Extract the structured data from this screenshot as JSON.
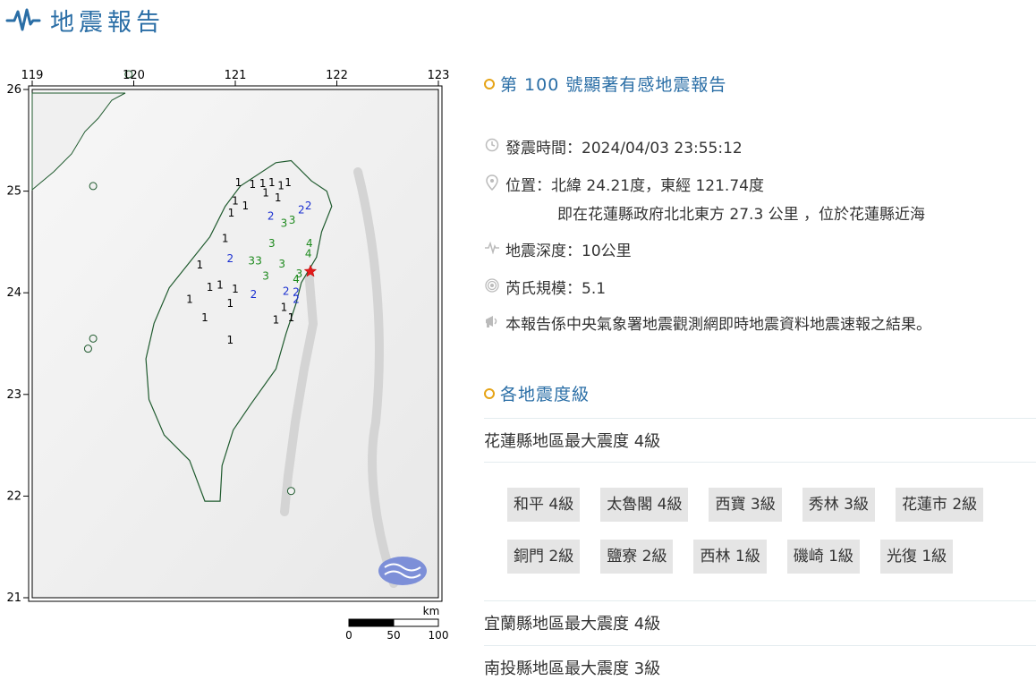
{
  "header": {
    "title": "地震報告",
    "icon": "seismograph-icon",
    "accent": "#2a6ea6"
  },
  "map": {
    "lon_ticks": [
      "119",
      "120",
      "121",
      "122",
      "123"
    ],
    "lat_ticks": [
      "26",
      "25",
      "24",
      "23",
      "22",
      "21"
    ],
    "scale_label": "km",
    "scale_ticks": [
      "0",
      "50",
      "100"
    ],
    "epicenter_marker": "red-star-icon",
    "intensity_labels": [
      {
        "v": "1",
        "lon": 121.03,
        "lat": 25.05
      },
      {
        "v": "1",
        "lon": 121.17,
        "lat": 25.03
      },
      {
        "v": "1",
        "lon": 121.27,
        "lat": 25.04
      },
      {
        "v": "1",
        "lon": 121.36,
        "lat": 25.05
      },
      {
        "v": "1",
        "lon": 121.45,
        "lat": 25.02
      },
      {
        "v": "1",
        "lon": 121.52,
        "lat": 25.05
      },
      {
        "v": "1",
        "lon": 121.0,
        "lat": 24.87
      },
      {
        "v": "1",
        "lon": 121.1,
        "lat": 24.82
      },
      {
        "v": "1",
        "lon": 120.96,
        "lat": 24.75
      },
      {
        "v": "1",
        "lon": 121.3,
        "lat": 24.95
      },
      {
        "v": "1",
        "lon": 121.42,
        "lat": 24.9
      },
      {
        "v": "2",
        "lon": 121.35,
        "lat": 24.72
      },
      {
        "v": "2",
        "lon": 121.65,
        "lat": 24.78
      },
      {
        "v": "2",
        "lon": 121.72,
        "lat": 24.82
      },
      {
        "v": "3",
        "lon": 121.48,
        "lat": 24.65
      },
      {
        "v": "3",
        "lon": 121.56,
        "lat": 24.68
      },
      {
        "v": "3",
        "lon": 121.36,
        "lat": 24.45
      },
      {
        "v": "1",
        "lon": 120.9,
        "lat": 24.5
      },
      {
        "v": "2",
        "lon": 120.95,
        "lat": 24.3
      },
      {
        "v": "3",
        "lon": 121.16,
        "lat": 24.28
      },
      {
        "v": "3",
        "lon": 121.23,
        "lat": 24.28
      },
      {
        "v": "3",
        "lon": 121.46,
        "lat": 24.25
      },
      {
        "v": "4",
        "lon": 121.73,
        "lat": 24.45
      },
      {
        "v": "4",
        "lon": 121.72,
        "lat": 24.35
      },
      {
        "v": "3",
        "lon": 121.63,
        "lat": 24.15
      },
      {
        "v": "4",
        "lon": 121.6,
        "lat": 24.1
      },
      {
        "v": "3",
        "lon": 121.3,
        "lat": 24.13
      },
      {
        "v": "1",
        "lon": 120.65,
        "lat": 24.24
      },
      {
        "v": "1",
        "lon": 120.75,
        "lat": 24.02
      },
      {
        "v": "1",
        "lon": 120.85,
        "lat": 24.04
      },
      {
        "v": "1",
        "lon": 121.0,
        "lat": 24.0
      },
      {
        "v": "1",
        "lon": 120.55,
        "lat": 23.9
      },
      {
        "v": "1",
        "lon": 120.7,
        "lat": 23.72
      },
      {
        "v": "2",
        "lon": 121.18,
        "lat": 23.95
      },
      {
        "v": "2",
        "lon": 121.5,
        "lat": 23.98
      },
      {
        "v": "2",
        "lon": 121.6,
        "lat": 23.97
      },
      {
        "v": "2",
        "lon": 121.6,
        "lat": 23.9
      },
      {
        "v": "1",
        "lon": 121.48,
        "lat": 23.82
      },
      {
        "v": "1",
        "lon": 121.4,
        "lat": 23.7
      },
      {
        "v": "1",
        "lon": 121.55,
        "lat": 23.72
      },
      {
        "v": "1",
        "lon": 120.95,
        "lat": 23.86
      },
      {
        "v": "1",
        "lon": 120.95,
        "lat": 23.5
      }
    ]
  },
  "report": {
    "title": "第 100 號顯著有感地震報告",
    "time_label": "發震時間：2024/04/03 23:55:12",
    "location_label": "位置：北緯 24.21度，東經 121.74度",
    "location_detail": "即在花蓮縣政府北北東方 27.3 公里 ，位於花蓮縣近海",
    "depth_label": "地震深度：10公里",
    "magnitude_label": "芮氏規模：5.1",
    "note": "本報告係中央氣象署地震觀測網即時地震資料地震速報之結果。"
  },
  "intensity": {
    "title": "各地震度級",
    "counties": [
      {
        "label": "花蓮縣地區最大震度 4級"
      },
      {
        "label": "宜蘭縣地區最大震度 4級"
      },
      {
        "label": "南投縣地區最大震度 3級"
      }
    ],
    "stations": [
      "和平 4級",
      "太魯閣 4級",
      "西寶 3級",
      "秀林 3級",
      "花蓮市 2級",
      "銅門 2級",
      "鹽寮 2級",
      "西林 1級",
      "磯崎 1級",
      "光復 1級"
    ]
  }
}
